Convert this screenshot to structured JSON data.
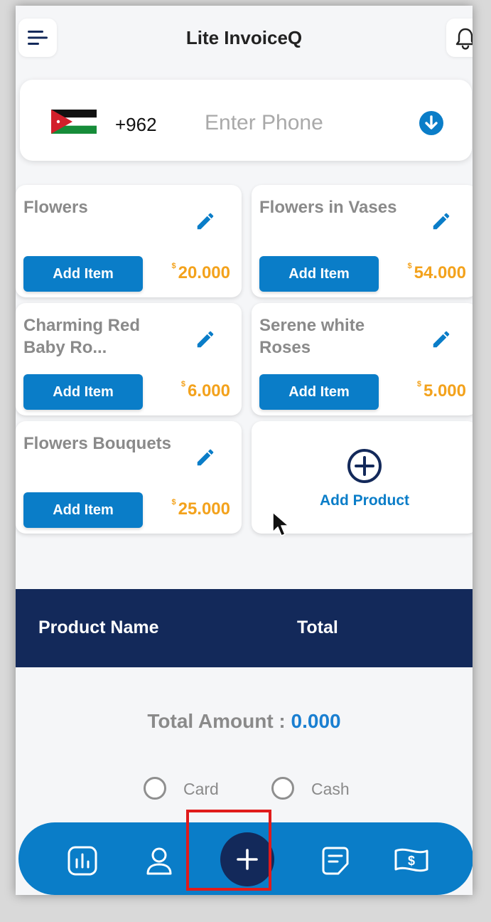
{
  "header": {
    "title": "Lite InvoiceQ"
  },
  "phone": {
    "dial_code": "+962",
    "placeholder": "Enter Phone",
    "value": ""
  },
  "products": [
    {
      "name": "Flowers",
      "price": "20.000",
      "currency": "$",
      "button": "Add Item"
    },
    {
      "name": "Flowers in Vases",
      "price": "54.000",
      "currency": "$",
      "button": "Add Item"
    },
    {
      "name": "Charming Red Baby Ro...",
      "price": "6.000",
      "currency": "$",
      "button": "Add Item"
    },
    {
      "name": "Serene white Roses",
      "price": "5.000",
      "currency": "$",
      "button": "Add Item"
    },
    {
      "name": "Flowers Bouquets",
      "price": "25.000",
      "currency": "$",
      "button": "Add Item"
    }
  ],
  "add_product": {
    "label": "Add Product"
  },
  "table": {
    "columns": [
      "Product Name",
      "Total"
    ]
  },
  "total": {
    "label": "Total Amount  :",
    "value": "0.000"
  },
  "payment": {
    "options": [
      "Card",
      "Cash"
    ]
  },
  "nav": {
    "items": [
      "chart-icon",
      "user-icon",
      "plus-icon",
      "note-icon",
      "money-icon"
    ]
  },
  "colors": {
    "primary": "#0a7dc8",
    "dark": "#13295a",
    "price": "#f3a21c",
    "highlight": "#e01b1b"
  }
}
